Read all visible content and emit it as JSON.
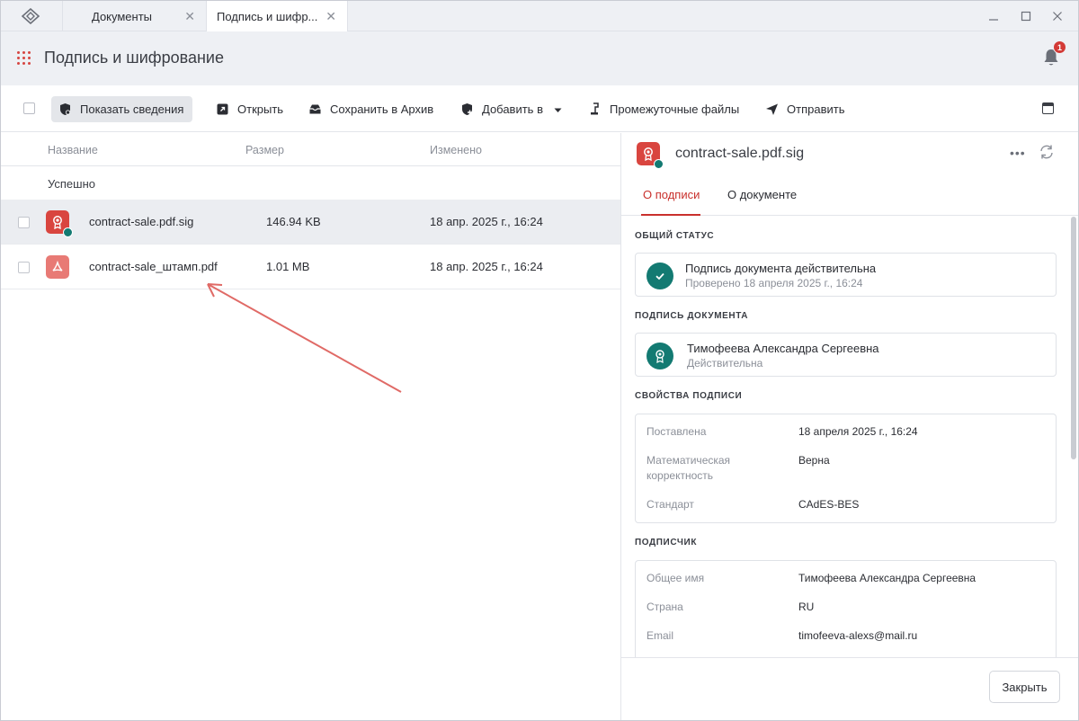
{
  "titlebar": {
    "tabs": [
      {
        "label": "Документы"
      },
      {
        "label": "Подпись и шифр..."
      }
    ],
    "close_glyph": "✕"
  },
  "header": {
    "title": "Подпись и шифрование",
    "notification_count": "1",
    "accent_color": "#d64541"
  },
  "toolbar": {
    "show_details": "Показать сведения",
    "open": "Открыть",
    "save_archive": "Сохранить в Архив",
    "add_to": "Добавить в",
    "intermediate_files": "Промежуточные файлы",
    "send": "Отправить"
  },
  "list": {
    "columns": {
      "name": "Название",
      "size": "Размер",
      "modified": "Изменено"
    },
    "group_label": "Успешно",
    "rows": [
      {
        "name": "contract-sale.pdf.sig",
        "size": "146.94 KB",
        "modified": "18 апр. 2025 г., 16:24",
        "icon": "signature-file-icon",
        "selected": true
      },
      {
        "name": "contract-sale_штамп.pdf",
        "size": "1.01 MB",
        "modified": "18 апр. 2025 г., 16:24",
        "icon": "pdf-file-icon",
        "selected": false
      }
    ]
  },
  "detail": {
    "title": "contract-sale.pdf.sig",
    "more_glyph": "•••",
    "tabs": {
      "signature": "О подписи",
      "document": "О документе"
    },
    "general_status": {
      "heading": "ОБЩИЙ СТАТУС",
      "line1": "Подпись документа действительна",
      "line2": "Проверено 18 апреля 2025 г., 16:24"
    },
    "document_signature": {
      "heading": "ПОДПИСЬ ДОКУМЕНТА",
      "line1": "Тимофеева Александра Сергеевна",
      "line2": "Действительна"
    },
    "signature_properties": {
      "heading": "СВОЙСТВА ПОДПИСИ",
      "rows": [
        {
          "key": "Поставлена",
          "value": "18 апреля 2025 г., 16:24"
        },
        {
          "key1": "Математическая",
          "key2": "корректность",
          "value": "Верна"
        },
        {
          "key": "Стандарт",
          "value": "CAdES-BES"
        }
      ]
    },
    "signer": {
      "heading": "ПОДПИСЧИК",
      "rows": [
        {
          "key": "Общее имя",
          "value": "Тимофеева Александра Сергеевна"
        },
        {
          "key": "Страна",
          "value": "RU"
        },
        {
          "key": "Email",
          "value": "timofeeva-alexs@mail.ru"
        }
      ]
    },
    "close_button": "Закрыть",
    "status_color": "#137a72"
  }
}
